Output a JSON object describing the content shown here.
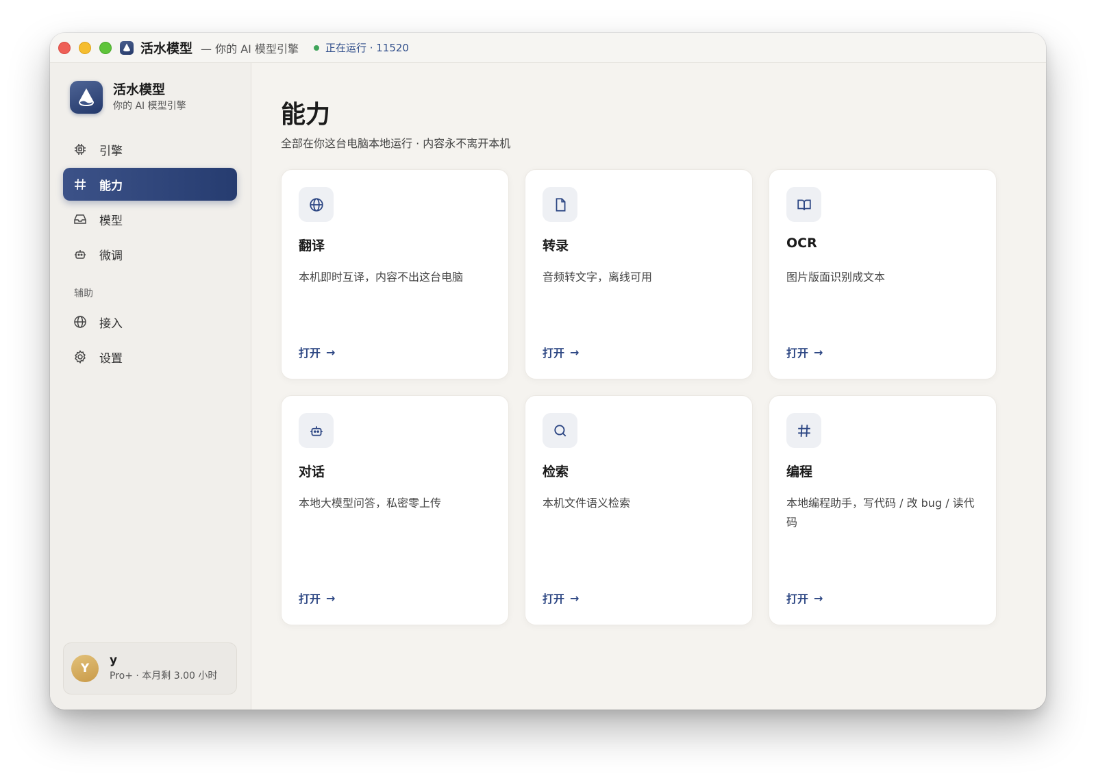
{
  "titlebar": {
    "app_name": "活水模型",
    "subtitle": "— 你的 AI 模型引擎",
    "status": "正在运行 · 11520",
    "status_color": "#3fa45a"
  },
  "brand": {
    "name": "活水模型",
    "tagline": "你的 AI 模型引擎",
    "icon": "water-drop-icon"
  },
  "sidebar": {
    "items": [
      {
        "label": "引擎",
        "icon": "chip-icon",
        "active": false
      },
      {
        "label": "能力",
        "icon": "hash-icon",
        "active": true
      },
      {
        "label": "模型",
        "icon": "inbox-icon",
        "active": false
      },
      {
        "label": "微调",
        "icon": "robot-icon",
        "active": false
      }
    ],
    "section_label": "辅助",
    "aux_items": [
      {
        "label": "接入",
        "icon": "globe-icon"
      },
      {
        "label": "设置",
        "icon": "gear-icon"
      }
    ]
  },
  "user": {
    "avatar_letter": "Y",
    "name": "y",
    "plan": "Pro+ · 本月剩 3.00 小时"
  },
  "main": {
    "title": "能力",
    "subtitle": "全部在你这台电脑本地运行 · 内容永不离开本机",
    "cards": [
      {
        "title": "翻译",
        "desc": "本机即时互译，内容不出这台电脑",
        "open": "打开",
        "icon": "globe-icon"
      },
      {
        "title": "转录",
        "desc": "音频转文字，离线可用",
        "open": "打开",
        "icon": "file-icon"
      },
      {
        "title": "OCR",
        "desc": "图片版面识别成文本",
        "open": "打开",
        "icon": "book-icon"
      },
      {
        "title": "对话",
        "desc": "本地大模型问答，私密零上传",
        "open": "打开",
        "icon": "robot-icon"
      },
      {
        "title": "检索",
        "desc": "本机文件语义检索",
        "open": "打开",
        "icon": "search-icon"
      },
      {
        "title": "编程",
        "desc": "本地编程助手，写代码 / 改 bug / 读代码",
        "open": "打开",
        "icon": "hash-icon"
      }
    ]
  },
  "colors": {
    "accent": "#2c4683",
    "active_nav": "#263c70"
  }
}
